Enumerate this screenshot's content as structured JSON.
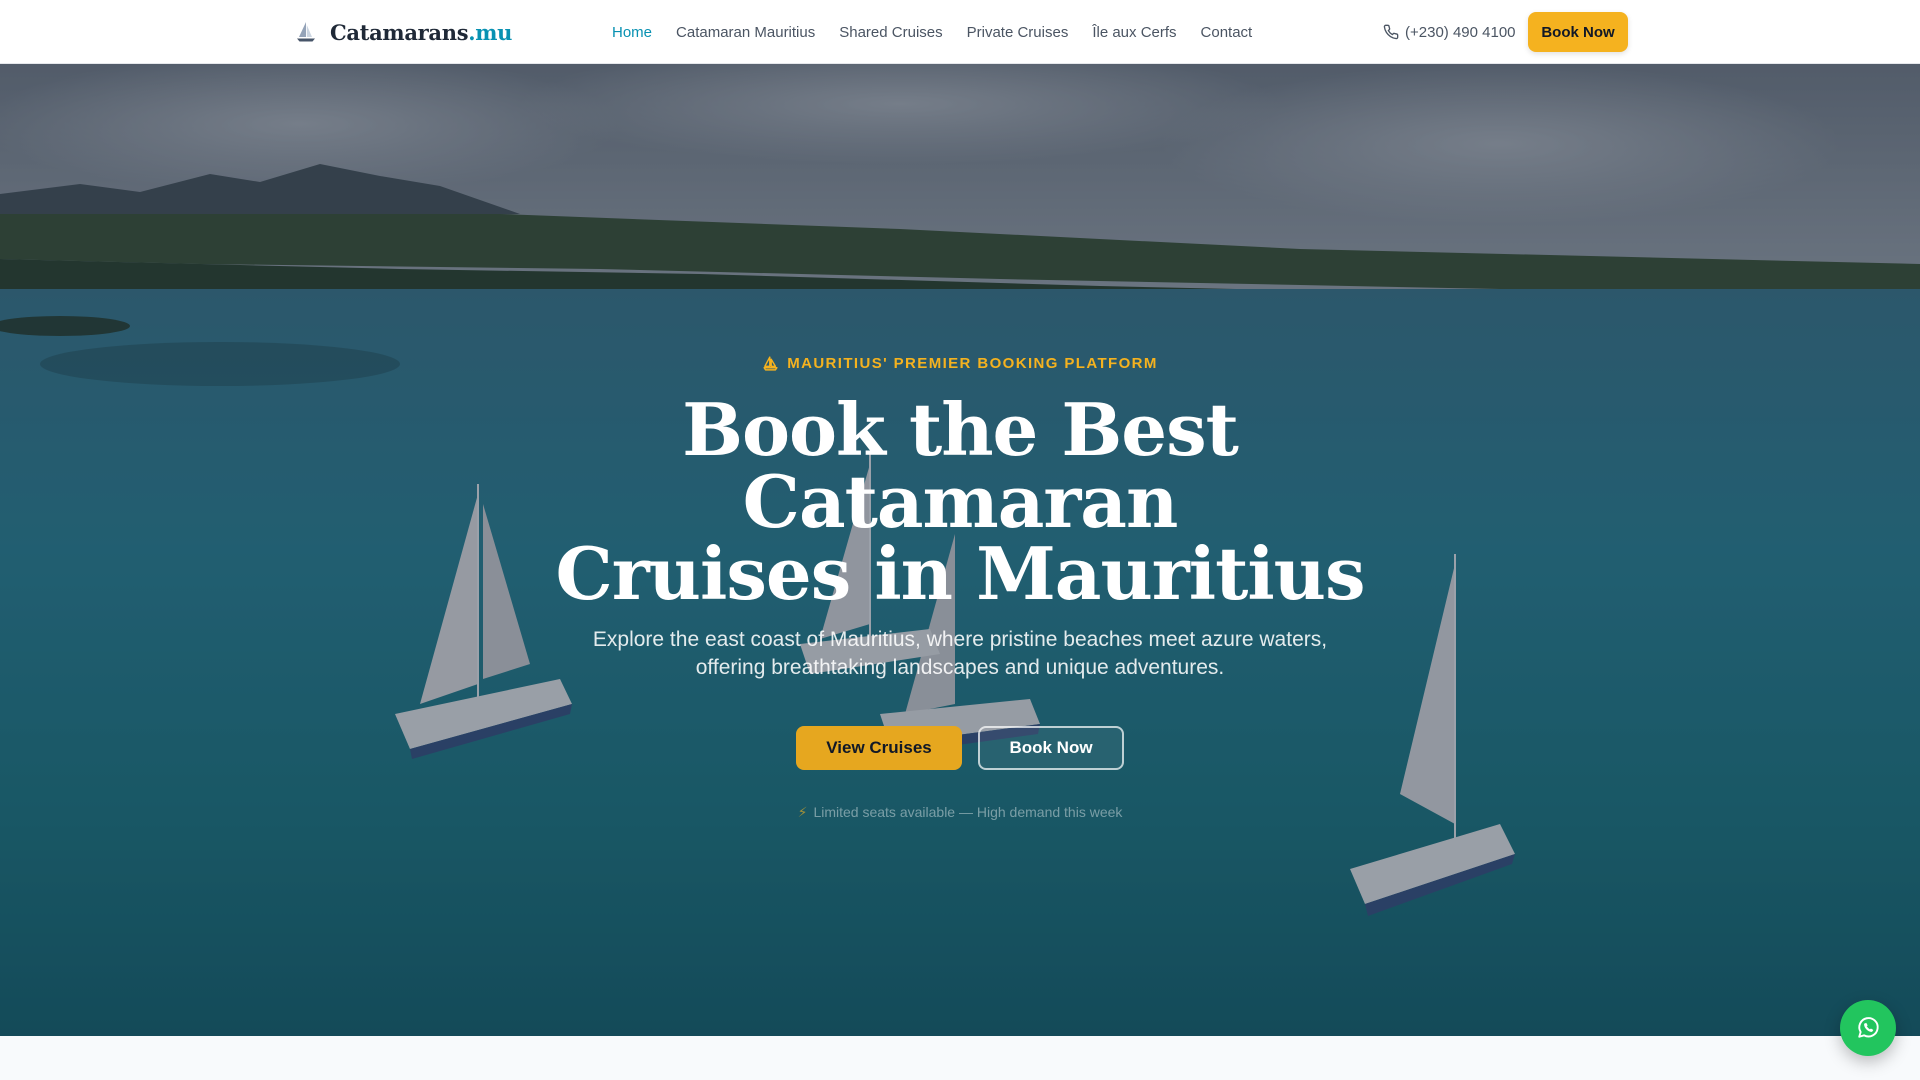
{
  "brand": {
    "name": "Catamarans",
    "tld": ".mu",
    "logo_icon": "sailboat-icon"
  },
  "nav": {
    "items": [
      {
        "label": "Home",
        "active": true
      },
      {
        "label": "Catamaran Mauritius",
        "active": false
      },
      {
        "label": "Shared Cruises",
        "active": false
      },
      {
        "label": "Private Cruises",
        "active": false
      },
      {
        "label": "Île aux Cerfs",
        "active": false
      },
      {
        "label": "Contact",
        "active": false
      }
    ]
  },
  "header": {
    "phone": "(+230) 490 4100",
    "phone_icon": "phone-icon",
    "cta_label": "Book Now"
  },
  "hero": {
    "eyebrow": "MAURITIUS' PREMIER BOOKING PLATFORM",
    "eyebrow_icon": "sailboat-icon",
    "title_line1": "Book the Best Catamaran",
    "title_line2": "Cruises in Mauritius",
    "subtitle": "Explore the east coast of Mauritius, where pristine beaches meet azure waters, offering breathtaking landscapes and unique adventures.",
    "primary_cta": "View Cruises",
    "secondary_cta": "Book Now",
    "urgency_icon": "lightning-icon",
    "urgency": "Limited seats available — High demand this week"
  },
  "floating": {
    "whatsapp_icon": "whatsapp-icon"
  },
  "colors": {
    "accent": "#0891b2",
    "cta": "#f5b21f",
    "whatsapp": "#22c55e",
    "text_dark": "#1f2937"
  }
}
